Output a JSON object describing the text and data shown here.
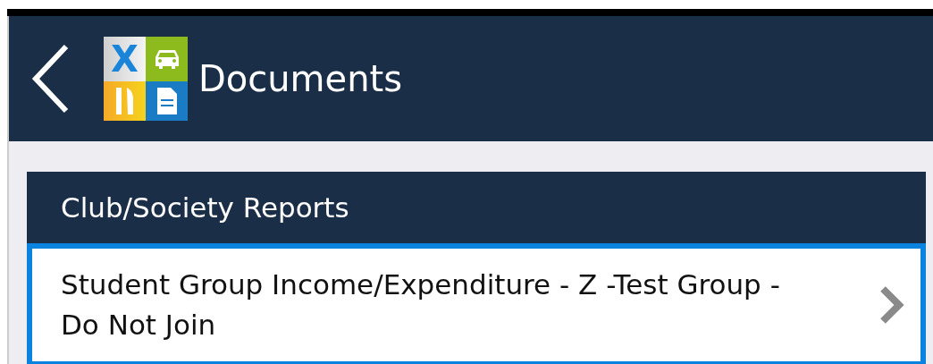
{
  "header": {
    "title": "Documents",
    "logo_letter": "X"
  },
  "sections": [
    {
      "title": "Club/Society Reports",
      "items": [
        {
          "label": "Student Group Income/Expenditure - Z -Test Group - Do Not Join",
          "selected": true
        }
      ]
    }
  ]
}
